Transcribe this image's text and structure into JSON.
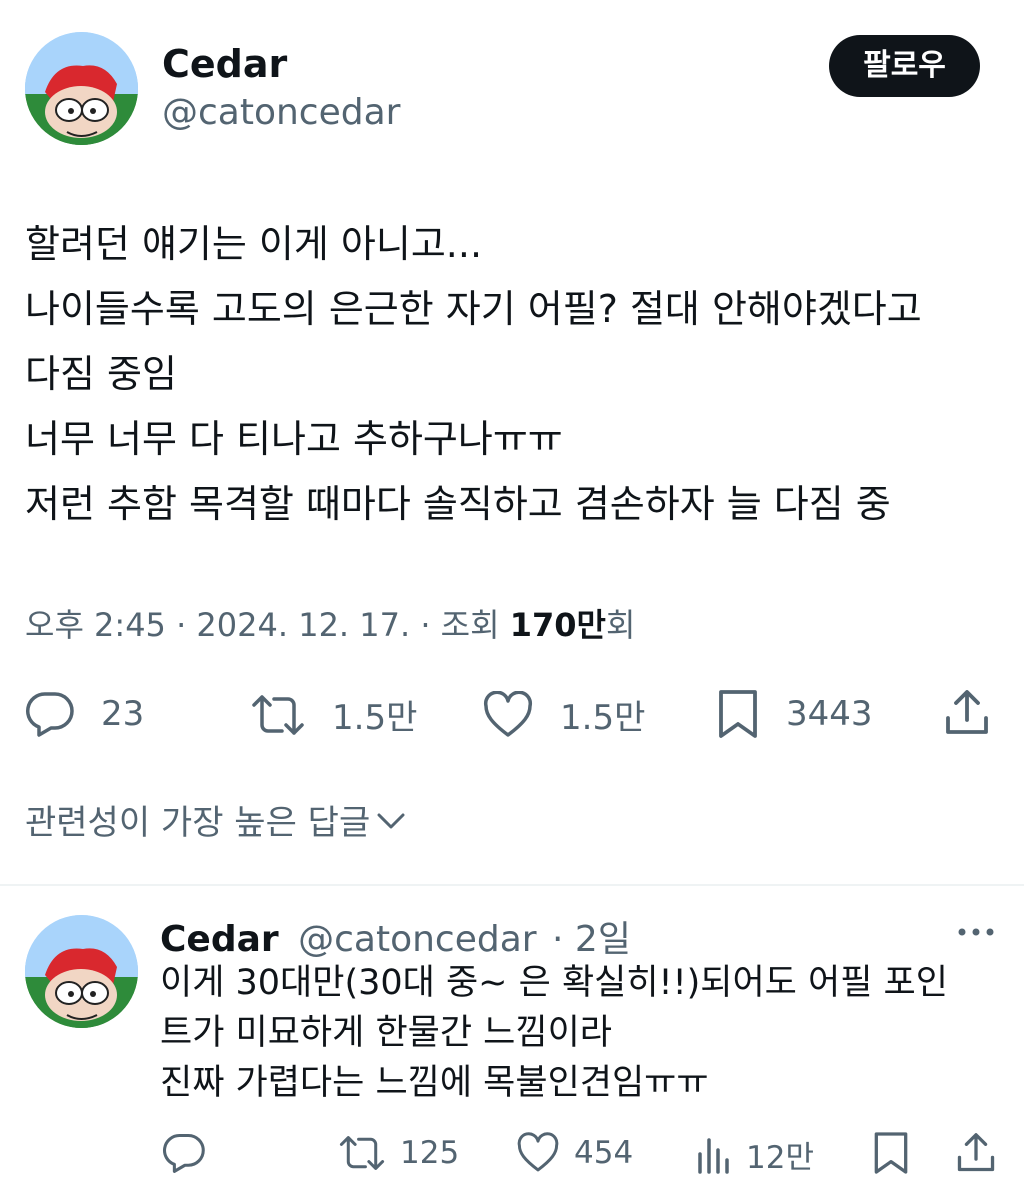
{
  "tweet": {
    "author_name": "Cedar",
    "author_handle": "@catoncedar",
    "follow_label": "팔로우",
    "lines": [
      "할려던 얘기는 이게 아니고...",
      "나이들수록 고도의 은근한 자기 어필? 절대 안해야겠다고",
      "다짐 중임",
      "너무 너무 다 티나고 추하구나ㅠㅠ",
      "저런 추함 목격할 때마다 솔직하고 겸손하자 늘 다짐 중"
    ],
    "meta_time": "오후 2:45 · 2024. 12. 17. · 조회 ",
    "meta_views": "170만",
    "meta_views_suffix": "회",
    "stats": {
      "replies": "23",
      "retweets": "1.5만",
      "likes": "1.5만",
      "bookmarks": "3443"
    }
  },
  "replies_sort_label": "관련성이 가장 높은 답글",
  "reply": {
    "author_name": "Cedar",
    "author_handle": "@catoncedar",
    "time": "· 2일",
    "lines": [
      "이게 30대만(30대 중~ 은 확실히!!)되어도 어필 포인",
      "트가 미묘하게 한물간 느낌이라",
      "진짜 가렵다는 느낌에 목불인견임ㅠㅠ"
    ],
    "stats": {
      "retweets": "125",
      "likes": "454",
      "views": "12만"
    }
  },
  "icons": [
    "reply-icon",
    "retweet-icon",
    "like-icon",
    "bookmark-icon",
    "share-icon",
    "views-icon",
    "more-icon",
    "chevron-down-icon"
  ]
}
